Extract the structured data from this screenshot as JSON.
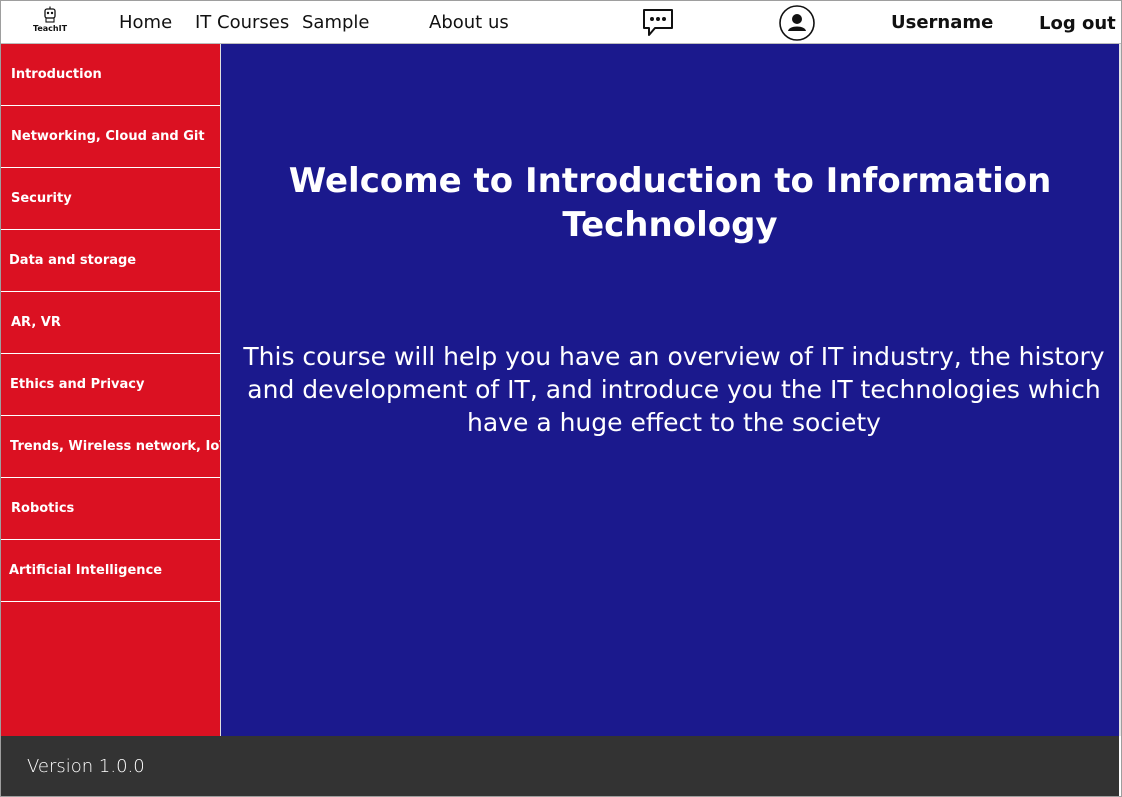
{
  "header": {
    "logo_text": "TeachIT",
    "nav": [
      "Home",
      "IT Courses",
      "Sample",
      "About us"
    ],
    "chat_icon": "chat-bubble-icon",
    "avatar_icon": "user-avatar-icon",
    "username": "Username",
    "logout": "Log out"
  },
  "sidebar": {
    "items": [
      {
        "label": "Introduction"
      },
      {
        "label": "Networking, Cloud and Git"
      },
      {
        "label": "Security"
      },
      {
        "label": "Data and storage"
      },
      {
        "label": "AR, VR"
      },
      {
        "label": "Ethics and Privacy"
      },
      {
        "label": "Trends, Wireless network, IoT"
      },
      {
        "label": "Robotics"
      },
      {
        "label": "Artificial Intelligence"
      }
    ]
  },
  "main": {
    "title": "Welcome to Introduction to Information Technology",
    "description": "This course will help you have an overview of IT industry, the history and development of IT, and introduce you the IT technologies which have a huge effect to the society"
  },
  "footer": {
    "version": "Version 1.0.0"
  },
  "colors": {
    "sidebar": "#db1122",
    "main": "#1b198d",
    "footer": "#333333"
  }
}
